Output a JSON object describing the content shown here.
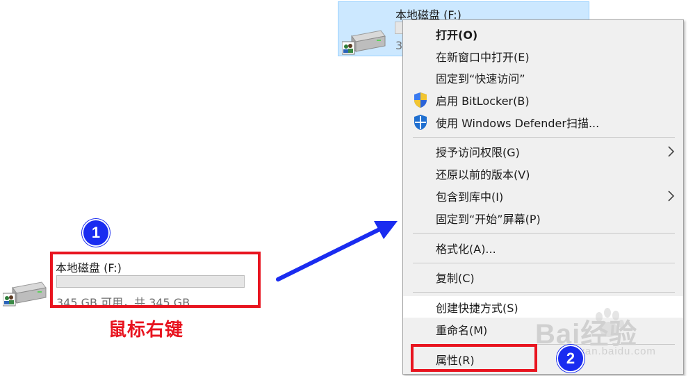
{
  "drive": {
    "name": "本地磁盘 (F:)",
    "free_text": "345 GB 可用，共 345 GB",
    "usage_fraction": 0.0
  },
  "selected_drive": {
    "name": "本地磁盘 (F:)",
    "free_text_partial": "34"
  },
  "annotations": {
    "step1_badge": "1",
    "step2_badge": "2",
    "caption": "鼠标右键",
    "highlight_color": "#e8141f",
    "badge_color": "#1a2cf0",
    "arrow_color": "#1a2cf0"
  },
  "context_menu": {
    "items": [
      {
        "label": "打开(O)",
        "bold": true
      },
      {
        "label": "在新窗口中打开(E)"
      },
      {
        "label": "固定到“快速访问”"
      },
      {
        "label": "启用 BitLocker(B)",
        "icon": "shield-uac-icon"
      },
      {
        "label": "使用 Windows Defender扫描...",
        "icon": "defender-icon"
      },
      {
        "label": "授予访问权限(G)",
        "submenu": true
      },
      {
        "label": "还原以前的版本(V)"
      },
      {
        "label": "包含到库中(I)",
        "submenu": true
      },
      {
        "label": "固定到“开始”屏幕(P)"
      },
      {
        "label": "格式化(A)..."
      },
      {
        "label": "复制(C)"
      },
      {
        "label": "创建快捷方式(S)",
        "hover": true
      },
      {
        "label": "重命名(M)"
      },
      {
        "label": "属性(R)"
      }
    ]
  },
  "watermark": {
    "brand": "Bai经验",
    "url": "jingyan.baidu.com"
  },
  "colors": {
    "selection_bg": "#cce8ff",
    "menu_bg": "#f0f0f0"
  }
}
